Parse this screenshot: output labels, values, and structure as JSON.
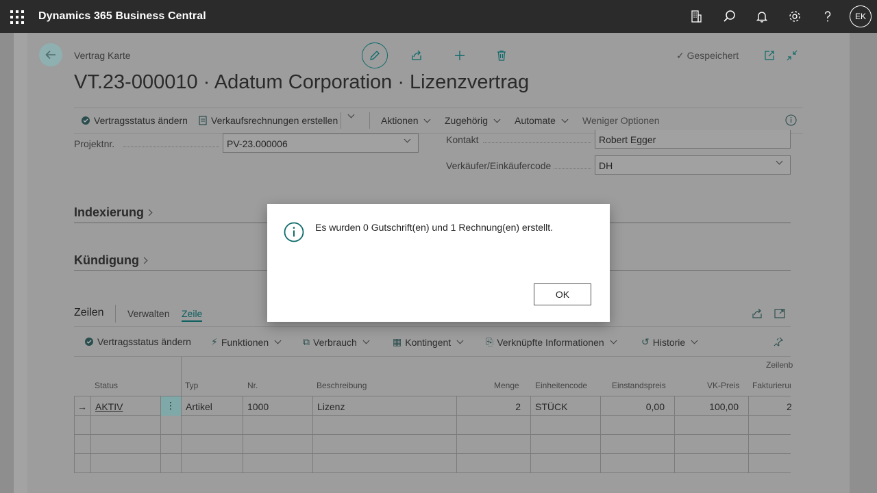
{
  "app": {
    "title": "Dynamics 365 Business Central",
    "user_initials": "EK"
  },
  "header": {
    "breadcrumb": "Vertrag Karte",
    "saved_label": "Gespeichert",
    "title": "VT.23-000010 · Adatum Corporation · Lizenzvertrag"
  },
  "actions": {
    "items": [
      "Vertragsstatus ändern",
      "Verkaufsrechnungen erstellen",
      "Aktionen",
      "Zugehörig",
      "Automate",
      "Weniger Optionen"
    ]
  },
  "fields": {
    "projekt_label": "Projektnr.",
    "projekt_value": "PV-23.000006",
    "kontakt_label": "Kontakt",
    "kontakt_value": "Robert Egger",
    "verkaeufer_label": "Verkäufer/Einkäufercode",
    "verkaeufer_value": "DH"
  },
  "sections": {
    "indexierung": "Indexierung",
    "kuendigung": "Kündigung"
  },
  "lines": {
    "title": "Zeilen",
    "tabs": [
      "Verwalten",
      "Zeile"
    ],
    "actions": [
      "Vertragsstatus ändern",
      "Funktionen",
      "Verbrauch",
      "Kontingent",
      "Verknüpfte Informationen",
      "Historie"
    ],
    "group_header": "Zeilenb",
    "columns": [
      "Status",
      "Typ",
      "Nr.",
      "Beschreibung",
      "Menge",
      "Einheitencode",
      "Einstandspreis",
      "VK-Preis",
      "Fakturierun"
    ],
    "rows": [
      {
        "status": "AKTIV",
        "typ": "Artikel",
        "nr": "1000",
        "beschreibung": "Lizenz",
        "menge": "2",
        "einheit": "STÜCK",
        "einstand": "0,00",
        "vk": "100,00",
        "fakt": "2"
      }
    ]
  },
  "dialog": {
    "message": "Es wurden 0 Gutschrift(en) und 1 Rechnung(en) erstellt.",
    "ok_label": "OK"
  },
  "colors": {
    "topbar": "#2b2b2b",
    "accent": "#0d6a6a",
    "overlay_page": "#9d9d9d"
  }
}
